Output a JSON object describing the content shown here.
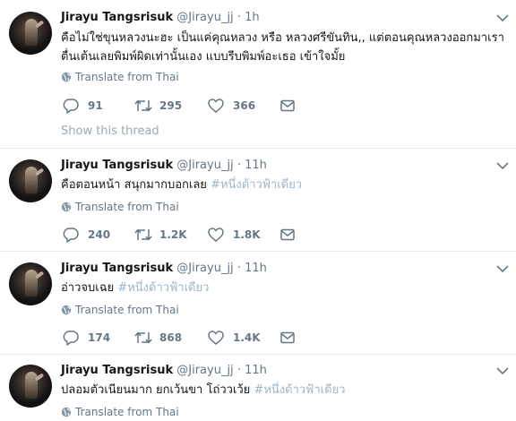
{
  "translate_label": "Translate from Thai",
  "show_thread_label": "Show this thread",
  "tweets": [
    {
      "name": "Jirayu Tangsrisuk",
      "handle": "@Jirayu_jj",
      "dot": "·",
      "time": "1h",
      "lines": [
        "คือไม่ใช่ขุนหลวงนะฮะ เป็นแค่คุณหลวง หรือ หลวงศรีขันทิน,, แต่ตอนคุณหลวงออกมาเรา",
        "ตื่นเต้นเลยพิมพ์ผิดเท่านั้นเอง แบบรีบพิมพ์อะเธอ เข้าใจมั้ย"
      ],
      "hashtag": "",
      "replies": "91",
      "retweets": "295",
      "likes": "366"
    },
    {
      "name": "Jirayu Tangsrisuk",
      "handle": "@Jirayu_jj",
      "dot": "·",
      "time": "11h",
      "lines": [
        "คือตอนหน้า สนุกมากบอกเลย "
      ],
      "hashtag": "#หนึ่งด้าวฟ้าเดียว",
      "replies": "240",
      "retweets": "1.2K",
      "likes": "1.8K"
    },
    {
      "name": "Jirayu Tangsrisuk",
      "handle": "@Jirayu_jj",
      "dot": "·",
      "time": "11h",
      "lines": [
        "อ่าวจบเฉย "
      ],
      "hashtag": "#หนึ่งด้าวฟ้าเดียว",
      "replies": "174",
      "retweets": "868",
      "likes": "1.4K"
    },
    {
      "name": "Jirayu Tangsrisuk",
      "handle": "@Jirayu_jj",
      "dot": "·",
      "time": "11h",
      "lines": [
        "ปลอมตัวเนียนมาก ยกเว้นขา โถ่ววเว้ย "
      ],
      "hashtag": "#หนึ่งด้าวฟ้าเดียว"
    }
  ],
  "colors": {
    "text": "#14171a",
    "secondary": "#657786",
    "hashtag": "#9fb5c7",
    "border": "#e6ecf0"
  },
  "icons": [
    "globe-icon",
    "reply-icon",
    "retweet-icon",
    "like-icon",
    "message-icon",
    "chevron-down-icon"
  ]
}
